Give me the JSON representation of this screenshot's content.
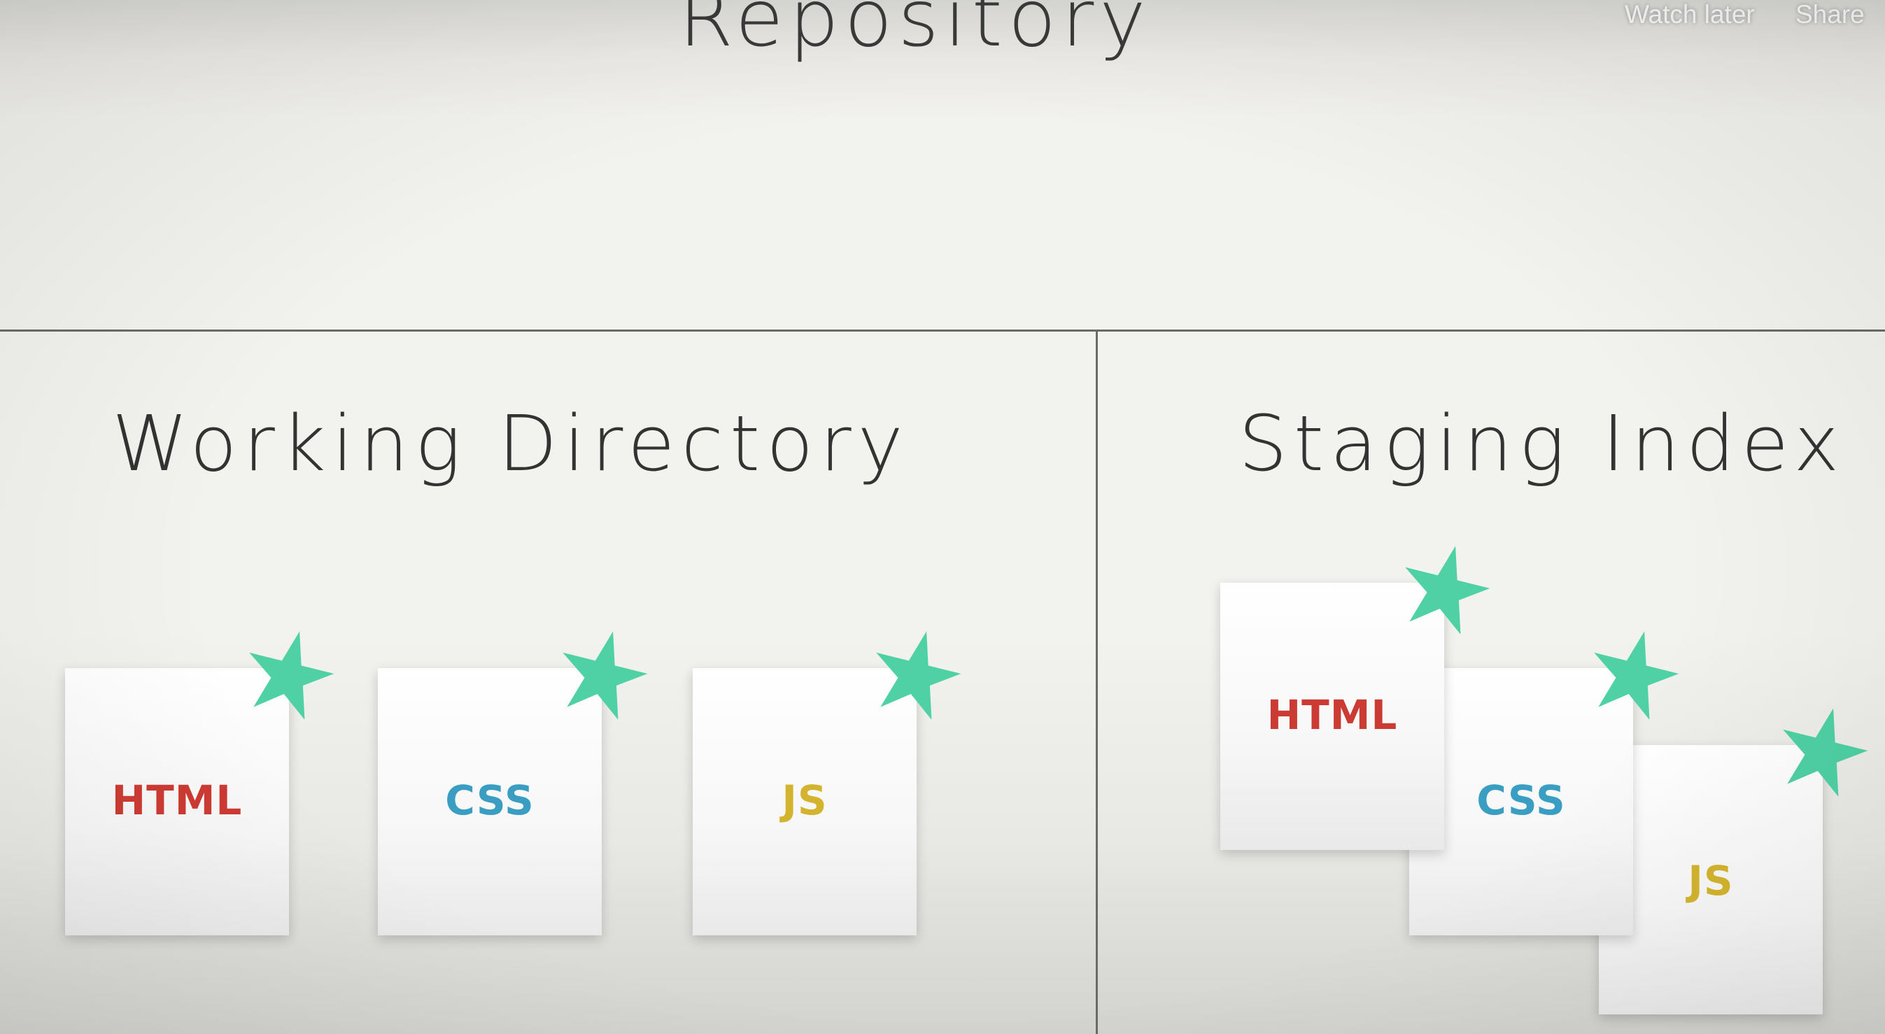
{
  "slide": {
    "repository_title": "Repository",
    "working_directory_title": "Working Directory",
    "staging_index_title": "Staging Index"
  },
  "player_overlay": {
    "watch_later": "Watch later",
    "share": "Share"
  },
  "working_directory_files": [
    {
      "label": "HTML",
      "color": "#cc3b33"
    },
    {
      "label": "CSS",
      "color": "#3a9ec2"
    },
    {
      "label": "JS",
      "color": "#d4b42e"
    }
  ],
  "staging_index_files": [
    {
      "label": "HTML",
      "color": "#cc3b33"
    },
    {
      "label": "CSS",
      "color": "#3a9ec2"
    },
    {
      "label": "JS",
      "color": "#d4b42e"
    }
  ],
  "colors": {
    "star": "#4fd1a5",
    "background": "#f2f2ee",
    "divider": "#6a6a6a"
  },
  "icons": {
    "modified_marker": "star-icon"
  }
}
